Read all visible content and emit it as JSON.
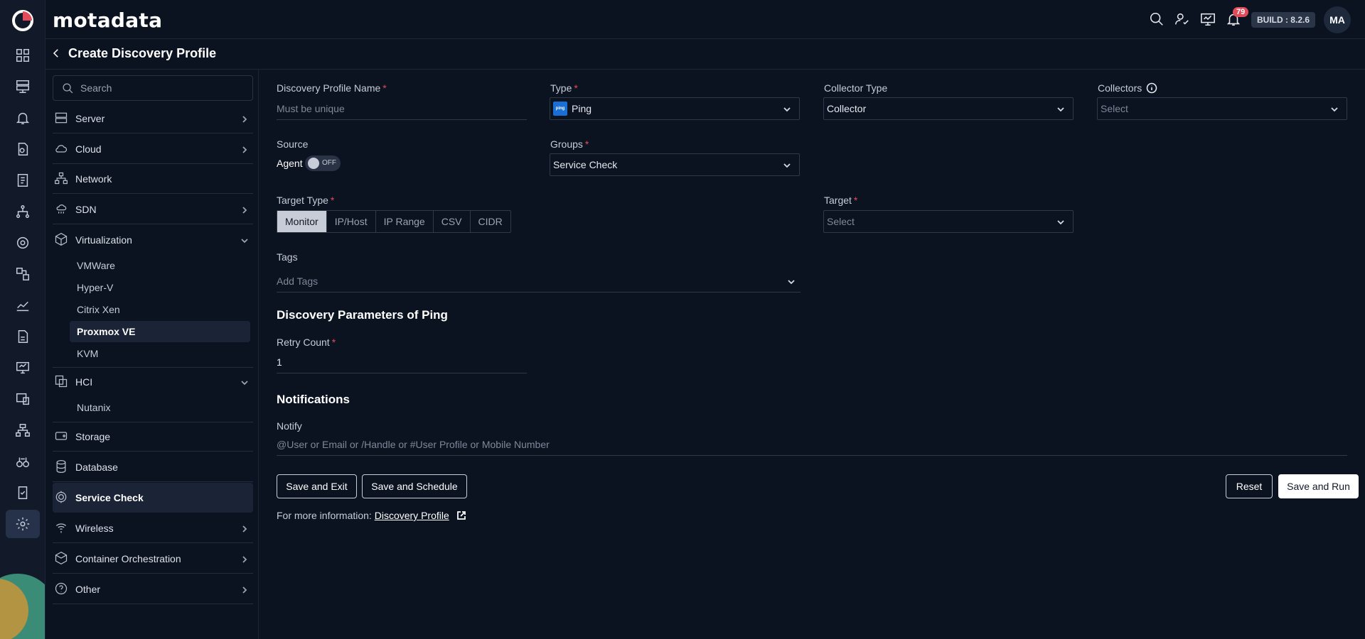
{
  "app": {
    "brand": "motadata",
    "build": "BUILD : 8.2.6",
    "avatar": "MA",
    "notifications": "79"
  },
  "page": {
    "title": "Create Discovery Profile"
  },
  "sidebar": {
    "search_placeholder": "Search",
    "categories": [
      {
        "label": "Server"
      },
      {
        "label": "Cloud"
      },
      {
        "label": "Network"
      },
      {
        "label": "SDN"
      },
      {
        "label": "Virtualization",
        "children": [
          "VMWare",
          "Hyper-V",
          "Citrix Xen",
          "Proxmox VE",
          "KVM"
        ]
      },
      {
        "label": "HCI",
        "children": [
          "Nutanix"
        ]
      },
      {
        "label": "Storage"
      },
      {
        "label": "Database"
      },
      {
        "label": "Service Check"
      },
      {
        "label": "Wireless"
      },
      {
        "label": "Container Orchestration"
      },
      {
        "label": "Other"
      }
    ],
    "selected_category": "Service Check",
    "selected_sub": "Proxmox VE"
  },
  "form": {
    "profile_name": {
      "label": "Discovery Profile Name",
      "placeholder": "Must be unique"
    },
    "type": {
      "label": "Type",
      "value": "Ping",
      "icon_text": "ping"
    },
    "collector_type": {
      "label": "Collector Type",
      "value": "Collector"
    },
    "collectors": {
      "label": "Collectors",
      "placeholder": "Select"
    },
    "source": {
      "label": "Source",
      "agent_label": "Agent",
      "toggle": "OFF"
    },
    "groups": {
      "label": "Groups",
      "value": "Service Check"
    },
    "target_type": {
      "label": "Target Type",
      "options": [
        "Monitor",
        "IP/Host",
        "IP Range",
        "CSV",
        "CIDR"
      ],
      "selected": "Monitor"
    },
    "target": {
      "label": "Target",
      "placeholder": "Select"
    },
    "tags": {
      "label": "Tags",
      "placeholder": "Add Tags"
    },
    "params_title": "Discovery Parameters of Ping",
    "retry": {
      "label": "Retry Count",
      "value": "1"
    },
    "notifications_title": "Notifications",
    "notify": {
      "label": "Notify",
      "placeholder": "@User or Email or /Handle or #User Profile or Mobile Number"
    }
  },
  "actions": {
    "save_exit": "Save and Exit",
    "save_schedule": "Save and Schedule",
    "reset": "Reset",
    "save_run": "Save and Run"
  },
  "more_info": {
    "text": "For more information:",
    "link": "Discovery Profile"
  },
  "colors": {
    "bg": "#0b1220",
    "rail": "#121a2a",
    "accent_red": "#e14b5a",
    "ping_blue": "#1a6fd6"
  }
}
